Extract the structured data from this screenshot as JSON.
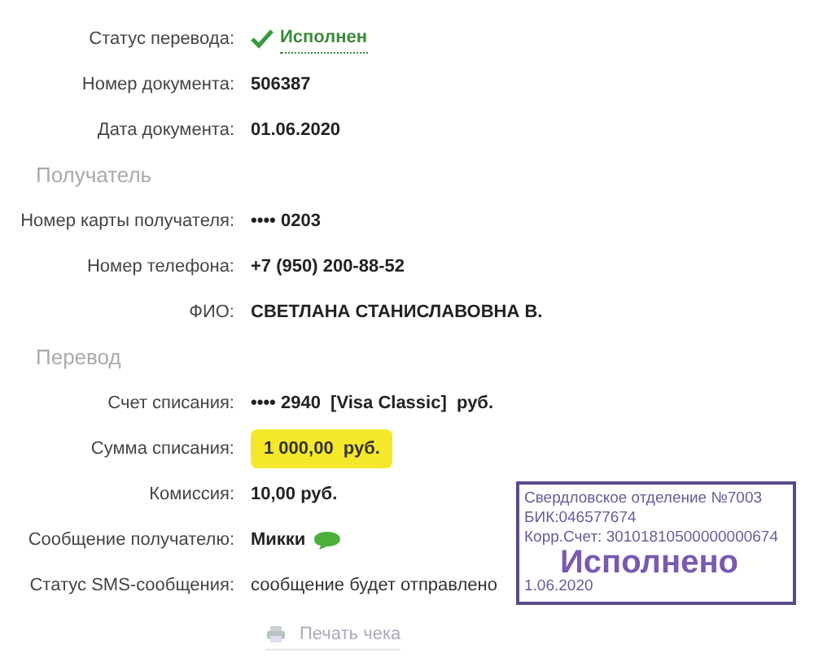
{
  "groups": [
    {
      "rows": [
        {
          "label": "Статус перевода:",
          "value": "Исполнен",
          "kind": "status"
        },
        {
          "label": "Номер документа:",
          "value": "506387",
          "kind": "bold"
        },
        {
          "label": "Дата документа:",
          "value": "01.06.2020",
          "kind": "bold"
        }
      ]
    },
    {
      "heading": "Получатель",
      "rows": [
        {
          "label": "Номер карты получателя:",
          "value": "•••• 0203",
          "kind": "bold"
        },
        {
          "label": "Номер телефона:",
          "value": "+7 (950) 200-88-52",
          "kind": "bold"
        },
        {
          "label": "ФИО:",
          "value": "СВЕТЛАНА СТАНИСЛАВОВНА В.",
          "kind": "bold"
        }
      ]
    },
    {
      "heading": "Перевод",
      "rows": [
        {
          "label": "Счет списания:",
          "value": "•••• 2940  [Visa Classic]  руб.",
          "kind": "bold"
        },
        {
          "label": "Сумма списания:",
          "value": "1 000,00  руб.",
          "kind": "highlight"
        },
        {
          "label": "Комиссия:",
          "value": "10,00 руб.",
          "kind": "bold"
        },
        {
          "label": "Сообщение получателю:",
          "value": "Микки",
          "kind": "sms"
        },
        {
          "label": "Статус SMS-сообщения:",
          "value": "сообщение будет отправлено",
          "kind": "plain"
        }
      ]
    }
  ],
  "print_link": "Печать чека",
  "stamp": {
    "lines": [
      "Свердловское отделение №7003",
      "БИК:046577674",
      "Корр.Счет: 30101810500000000674"
    ],
    "status": "Исполнено",
    "date": "1.06.2020"
  }
}
